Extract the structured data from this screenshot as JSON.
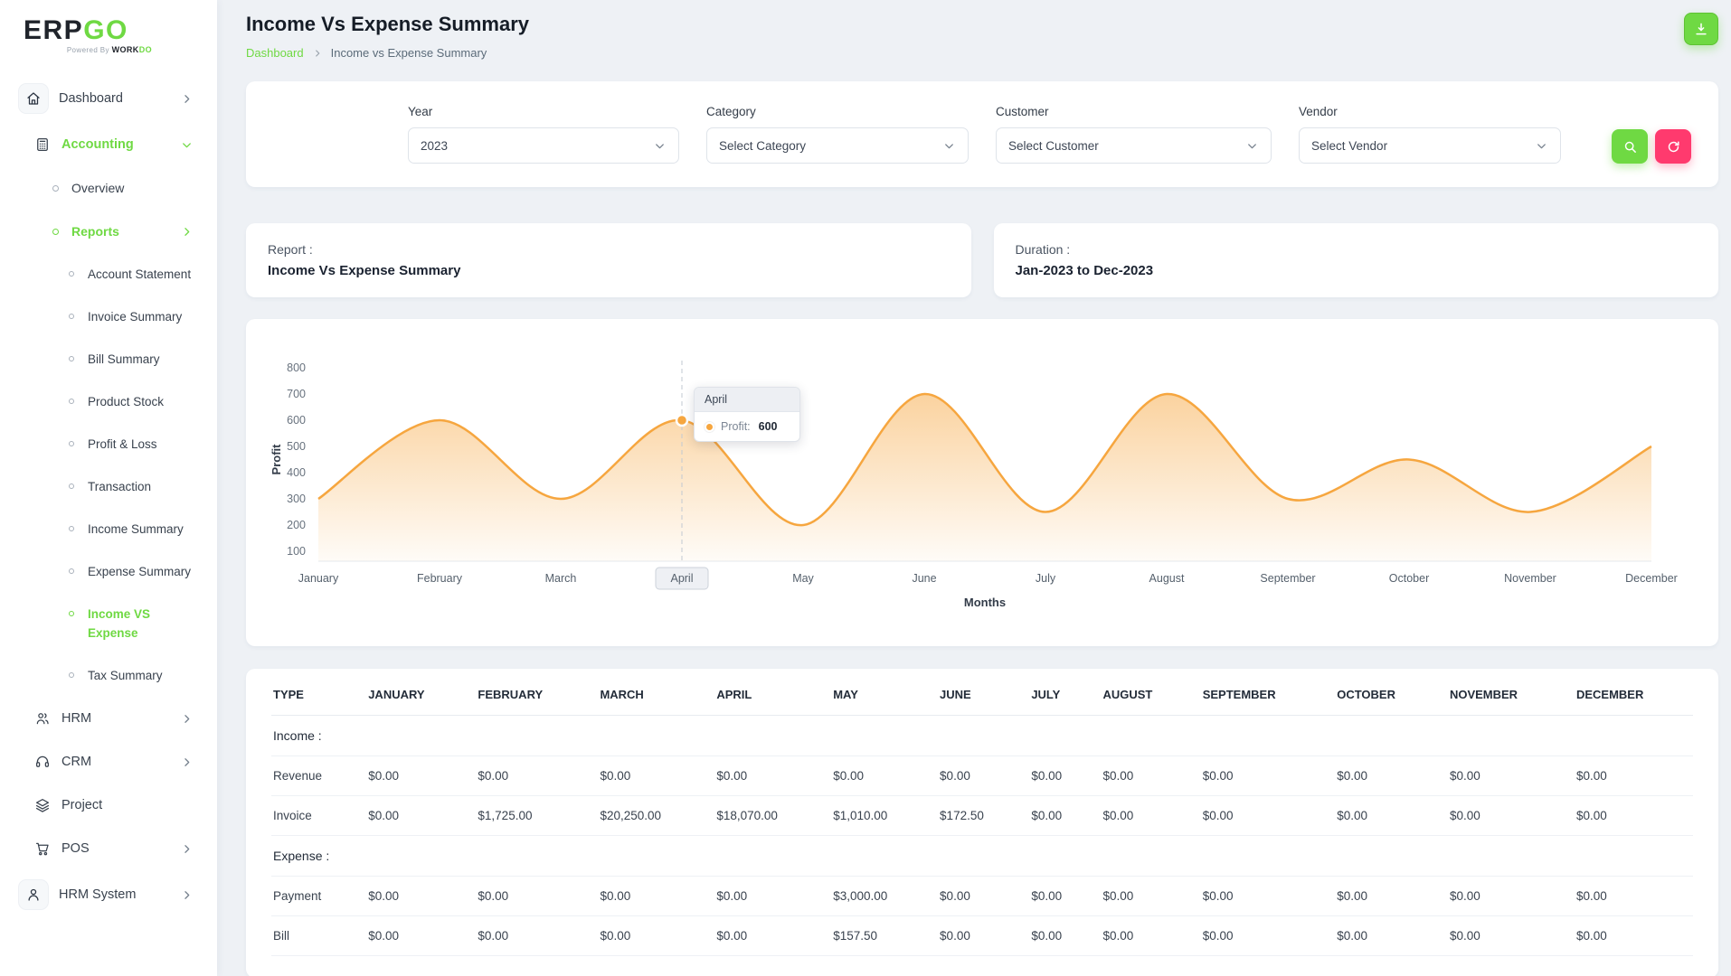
{
  "brand": {
    "name_primary": "ERP",
    "name_secondary": "GO",
    "tagline_prefix": "Powered By",
    "tagline_word1": "WORK",
    "tagline_word2": "DO"
  },
  "sidebar": {
    "items": [
      {
        "id": "dashboard",
        "label": "Dashboard",
        "icon": "home-icon",
        "style": "boxed",
        "chevron": "right"
      },
      {
        "id": "accounting",
        "label": "Accounting",
        "icon": "accounting-icon",
        "style": "top",
        "chevron": "down",
        "active": true
      },
      {
        "id": "overview",
        "label": "Overview",
        "style": "sub"
      },
      {
        "id": "reports",
        "label": "Reports",
        "style": "sub",
        "chevron": "right",
        "active": true
      },
      {
        "id": "account-statement",
        "label": "Account Statement",
        "style": "subsub"
      },
      {
        "id": "invoice-summary",
        "label": "Invoice Summary",
        "style": "subsub"
      },
      {
        "id": "bill-summary",
        "label": "Bill Summary",
        "style": "subsub"
      },
      {
        "id": "product-stock",
        "label": "Product Stock",
        "style": "subsub"
      },
      {
        "id": "profit-loss",
        "label": "Profit & Loss",
        "style": "subsub"
      },
      {
        "id": "transaction",
        "label": "Transaction",
        "style": "subsub"
      },
      {
        "id": "income-summary",
        "label": "Income Summary",
        "style": "subsub"
      },
      {
        "id": "expense-summary",
        "label": "Expense Summary",
        "style": "subsub"
      },
      {
        "id": "income-vs-expense",
        "label": "Income VS Expense",
        "style": "subsub",
        "active": true
      },
      {
        "id": "tax-summary",
        "label": "Tax Summary",
        "style": "subsub"
      },
      {
        "id": "hrm",
        "label": "HRM",
        "icon": "hrm-icon",
        "style": "top",
        "chevron": "right"
      },
      {
        "id": "crm",
        "label": "CRM",
        "icon": "crm-icon",
        "style": "top",
        "chevron": "right"
      },
      {
        "id": "project",
        "label": "Project",
        "icon": "project-icon",
        "style": "top"
      },
      {
        "id": "pos",
        "label": "POS",
        "icon": "pos-icon",
        "style": "top",
        "chevron": "right"
      },
      {
        "id": "hrm-system",
        "label": "HRM System",
        "icon": "user-icon",
        "style": "boxed",
        "chevron": "right"
      }
    ]
  },
  "header": {
    "title": "Income Vs Expense Summary",
    "breadcrumb_home": "Dashboard",
    "breadcrumb_current": "Income vs Expense Summary"
  },
  "filters": {
    "year_label": "Year",
    "year_value": "2023",
    "category_label": "Category",
    "category_value": "Select Category",
    "customer_label": "Customer",
    "customer_value": "Select Customer",
    "vendor_label": "Vendor",
    "vendor_value": "Select Vendor"
  },
  "summary_cards": {
    "report_label": "Report :",
    "report_value": "Income Vs Expense Summary",
    "duration_label": "Duration :",
    "duration_value": "Jan-2023 to Dec-2023"
  },
  "chart_data": {
    "type": "area",
    "series": [
      {
        "name": "Profit",
        "values": [
          300,
          600,
          300,
          600,
          200,
          700,
          250,
          700,
          300,
          450,
          250,
          500
        ]
      }
    ],
    "categories": [
      "January",
      "February",
      "March",
      "April",
      "May",
      "June",
      "July",
      "August",
      "September",
      "October",
      "November",
      "December"
    ],
    "xlabel": "Months",
    "ylabel": "Profit",
    "ylim": [
      100,
      800
    ],
    "ytick_step": 100,
    "line_color": "#f6a63f",
    "legend_position": "none",
    "grid": false,
    "highlight": {
      "index": 3,
      "category": "April",
      "series": "Profit:",
      "value": "600"
    }
  },
  "table": {
    "headers": [
      "TYPE",
      "JANUARY",
      "FEBRUARY",
      "MARCH",
      "APRIL",
      "MAY",
      "JUNE",
      "JULY",
      "AUGUST",
      "SEPTEMBER",
      "OCTOBER",
      "NOVEMBER",
      "DECEMBER"
    ],
    "sections": [
      {
        "title": "Income :",
        "rows": [
          {
            "type": "Revenue",
            "values": [
              "$0.00",
              "$0.00",
              "$0.00",
              "$0.00",
              "$0.00",
              "$0.00",
              "$0.00",
              "$0.00",
              "$0.00",
              "$0.00",
              "$0.00",
              "$0.00"
            ]
          },
          {
            "type": "Invoice",
            "values": [
              "$0.00",
              "$1,725.00",
              "$20,250.00",
              "$18,070.00",
              "$1,010.00",
              "$172.50",
              "$0.00",
              "$0.00",
              "$0.00",
              "$0.00",
              "$0.00",
              "$0.00"
            ]
          }
        ]
      },
      {
        "title": "Expense :",
        "rows": [
          {
            "type": "Payment",
            "values": [
              "$0.00",
              "$0.00",
              "$0.00",
              "$0.00",
              "$3,000.00",
              "$0.00",
              "$0.00",
              "$0.00",
              "$0.00",
              "$0.00",
              "$0.00",
              "$0.00"
            ]
          },
          {
            "type": "Bill",
            "values": [
              "$0.00",
              "$0.00",
              "$0.00",
              "$0.00",
              "$157.50",
              "$0.00",
              "$0.00",
              "$0.00",
              "$0.00",
              "$0.00",
              "$0.00",
              "$0.00"
            ]
          }
        ]
      }
    ]
  },
  "colors": {
    "accent_green": "#6fd943",
    "accent_red": "#ff3a6e",
    "chart_orange": "#f6a63f"
  }
}
